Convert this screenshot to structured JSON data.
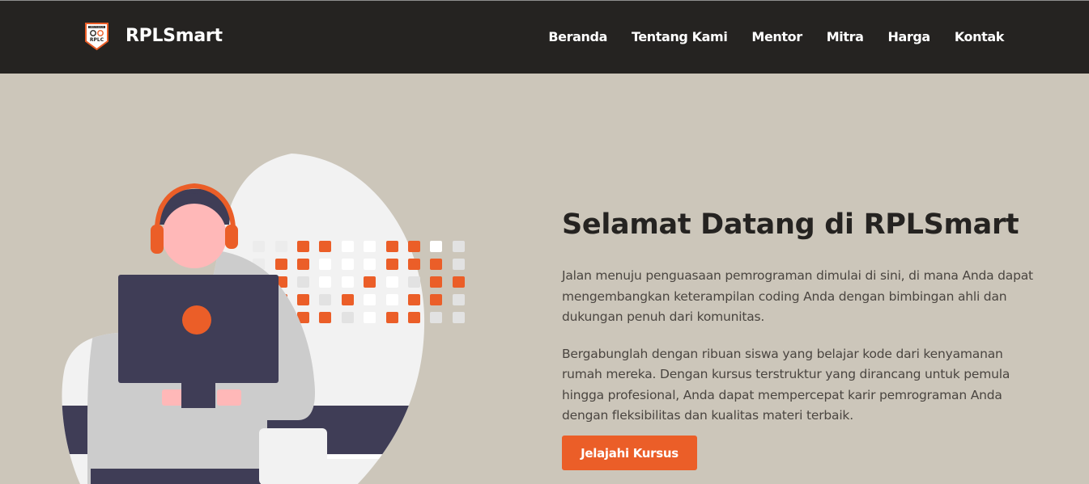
{
  "brand": {
    "name": "RPLSmart",
    "logo_icon": "rplc-shield-logo-icon",
    "logo_text_top": "SMKN RANAKAN",
    "logo_text_main": "RPLC"
  },
  "nav": {
    "items": [
      {
        "label": "Beranda"
      },
      {
        "label": "Tentang Kami"
      },
      {
        "label": "Mentor"
      },
      {
        "label": "Mitra"
      },
      {
        "label": "Harga"
      },
      {
        "label": "Kontak"
      }
    ]
  },
  "hero": {
    "title": "Selamat Datang di RPLSmart",
    "paragraph1": "Jalan menuju penguasaan pemrograman dimulai di sini, di mana Anda dapat mengembangkan keterampilan coding Anda dengan bimbingan ahli dan dukungan penuh dari komunitas.",
    "paragraph2": "Bergabunglah dengan ribuan siswa yang belajar kode dari kenyamanan rumah mereka. Dengan kursus terstruktur yang dirancang untuk pemula hingga profesional, Anda dapat mempercepat karir pemrograman Anda dengan fleksibilitas dan kualitas materi terbaik.",
    "cta_label": "Jelajahi Kursus",
    "illustration": "developer-with-headphones-at-computer-illustration"
  },
  "colors": {
    "navbar_bg": "#252321",
    "page_bg": "#ccc6ba",
    "accent": "#eb5e28",
    "heading": "#252321",
    "body_text": "#4a4540"
  }
}
